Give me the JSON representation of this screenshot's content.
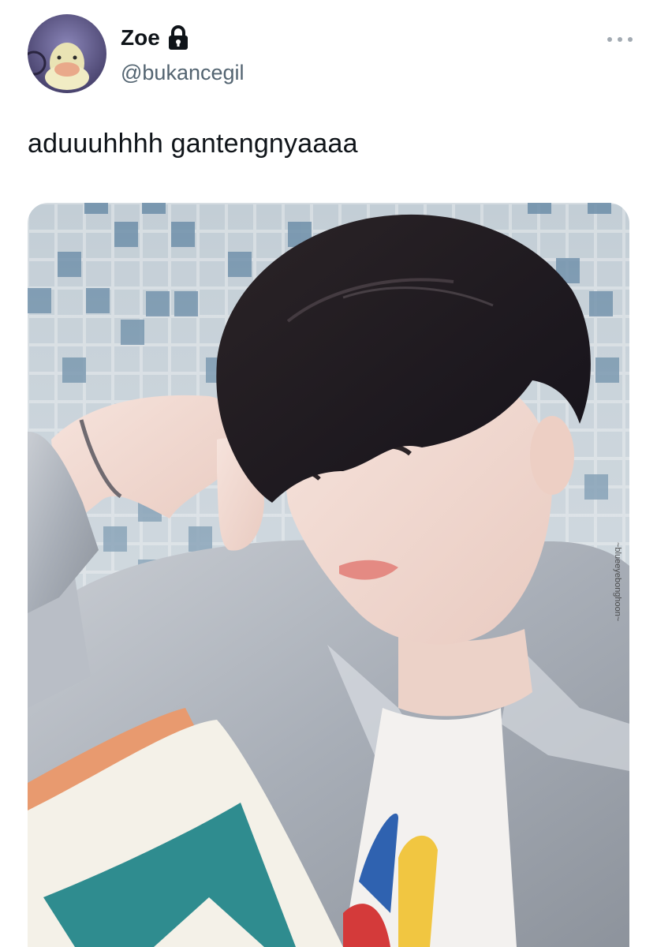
{
  "tweet": {
    "author": {
      "display_name": "Zoe",
      "handle": "@bukancegil",
      "protected": true,
      "avatar": "duck-avatar",
      "verified_icon": "lock-icon"
    },
    "text": "aduuuhhhh gantengnyaaaa",
    "media": {
      "type": "photo",
      "subject": "young man in light denim jacket with hand on head, reading, tiled wall background",
      "watermark": "~blueeyebonghoon~"
    },
    "menu_icon": "more-icon"
  },
  "colors": {
    "text_primary": "#0f1419",
    "text_secondary": "#536471",
    "more_dots": "#a2aab2",
    "background": "#ffffff"
  }
}
